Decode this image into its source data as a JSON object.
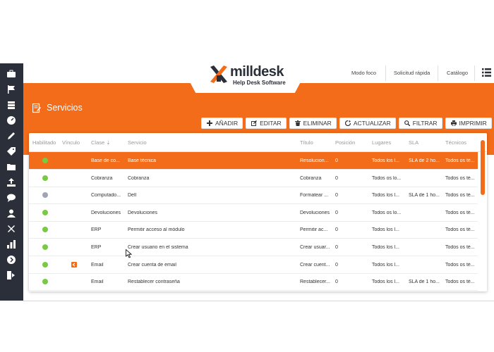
{
  "brand": {
    "name": "milldesk",
    "tagline": "Help Desk Software",
    "orange": "#f26c19",
    "dark": "#2b2f3a"
  },
  "topnav": {
    "links": [
      "Modo foco",
      "Solicitud rápida",
      "Catálogo"
    ]
  },
  "sidebar": {
    "icons": [
      "briefcase-icon",
      "flag-icon",
      "layers-icon",
      "dashboard-icon",
      "pencil-icon",
      "tag-icon",
      "folder-icon",
      "upload-icon",
      "chat-icon",
      "user-icon",
      "tools-icon",
      "bar-chart-icon",
      "arrow-circle-icon",
      "logout-icon"
    ]
  },
  "page": {
    "title": "Servicios"
  },
  "toolbar": {
    "add": "AÑADIR",
    "edit": "EDITAR",
    "delete": "ELIMINAR",
    "refresh": "ACTUALIZAR",
    "filter": "FILTRAR",
    "print": "IMPRIMIR"
  },
  "table": {
    "headers": {
      "habilitado": "Habilitado",
      "vinculo": "Vínculo",
      "clase": "Clase ⇣",
      "servicio": "Servicio",
      "titulo": "Título",
      "posicion": "Posición",
      "lugares": "Lugares",
      "sla": "SLA",
      "tecnicos": "Técnicos"
    },
    "rows": [
      {
        "enabled": "green",
        "link": false,
        "clase": "Base de co...",
        "servicio": "Base técnica",
        "titulo": "Resolucion...",
        "posicion": "0",
        "lugares": "Todos los l...",
        "sla": "SLA de 2 ho...",
        "tecnicos": "Todos os té...",
        "selected": true
      },
      {
        "enabled": "green",
        "link": false,
        "clase": "Cobranza",
        "servicio": "Cobranza",
        "titulo": "Cobranza",
        "posicion": "0",
        "lugares": "Todos os lo...",
        "sla": "",
        "tecnicos": "Todos os té...",
        "selected": false
      },
      {
        "enabled": "gray",
        "link": false,
        "clase": "Computado...",
        "servicio": "Dell",
        "titulo": "Formatear ...",
        "posicion": "0",
        "lugares": "Todos los l...",
        "sla": "SLA de 1 ho...",
        "tecnicos": "Todos os té...",
        "selected": false
      },
      {
        "enabled": "green",
        "link": false,
        "clase": "Devoluciones",
        "servicio": "Devoluciones",
        "titulo": "Devoluciones",
        "posicion": "0",
        "lugares": "Todos os lo...",
        "sla": "",
        "tecnicos": "Todos os té...",
        "selected": false
      },
      {
        "enabled": "green",
        "link": false,
        "clase": "ERP",
        "servicio": "Permitir acceso al módulo",
        "titulo": "Permitir ac...",
        "posicion": "0",
        "lugares": "Todos los l...",
        "sla": "",
        "tecnicos": "Todos os té...",
        "selected": false
      },
      {
        "enabled": "green",
        "link": false,
        "clase": "ERP",
        "servicio": "Crear usuario en el sistema",
        "titulo": "Crear usuar...",
        "posicion": "0",
        "lugares": "Todos los l...",
        "sla": "",
        "tecnicos": "Todos os té...",
        "selected": false
      },
      {
        "enabled": "green",
        "link": true,
        "clase": "Email",
        "servicio": "Crear cuenta de email",
        "titulo": "Crear cuent...",
        "posicion": "0",
        "lugares": "Todos los l...",
        "sla": "",
        "tecnicos": "Todos os té...",
        "selected": false
      },
      {
        "enabled": "green",
        "link": false,
        "clase": "Email",
        "servicio": "Restablecer contraseña",
        "titulo": "Restablecer...",
        "posicion": "0",
        "lugares": "Todos los l...",
        "sla": "SLA de 1 ho...",
        "tecnicos": "Todos os té...",
        "selected": false
      }
    ]
  },
  "status_colors": {
    "green": "#7ac943",
    "gray": "#a0a4b8",
    "link": "#f26c19"
  }
}
